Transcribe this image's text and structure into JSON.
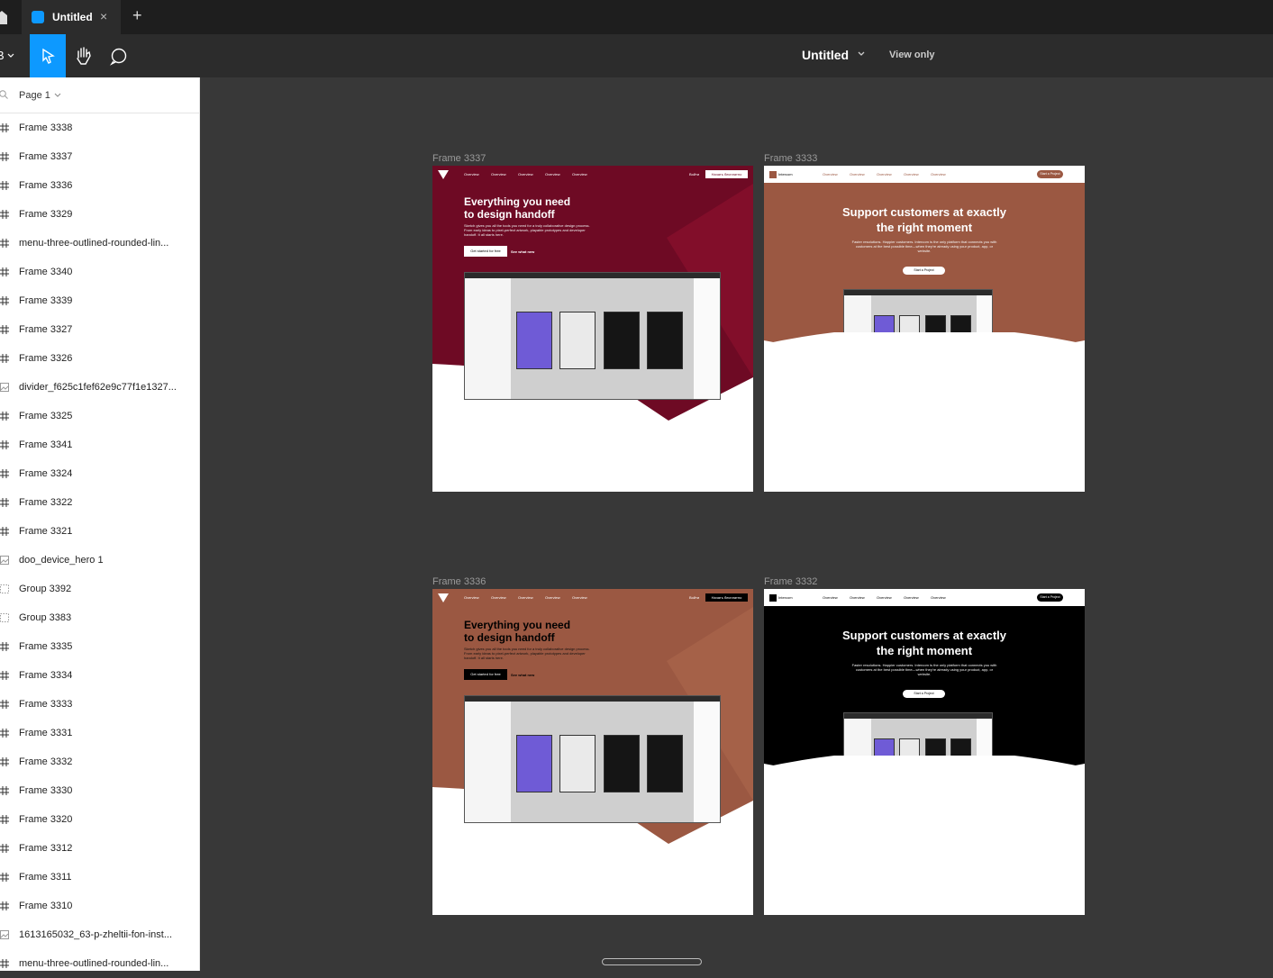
{
  "tab": {
    "title": "Untitled",
    "close": "×",
    "add": "+"
  },
  "toolbar": {
    "doc_title": "Untitled",
    "view_only": "View only"
  },
  "page": {
    "label": "Page 1"
  },
  "layers": [
    {
      "name": "Frame 3338",
      "type": "frame"
    },
    {
      "name": "Frame 3337",
      "type": "frame"
    },
    {
      "name": "Frame 3336",
      "type": "frame"
    },
    {
      "name": "Frame 3329",
      "type": "frame"
    },
    {
      "name": "menu-three-outlined-rounded-lin...",
      "type": "frame"
    },
    {
      "name": "Frame 3340",
      "type": "frame"
    },
    {
      "name": "Frame 3339",
      "type": "frame"
    },
    {
      "name": "Frame 3327",
      "type": "frame"
    },
    {
      "name": "Frame 3326",
      "type": "frame"
    },
    {
      "name": "divider_f625c1fef62e9c77f1e1327...",
      "type": "image"
    },
    {
      "name": "Frame 3325",
      "type": "frame"
    },
    {
      "name": "Frame 3341",
      "type": "frame"
    },
    {
      "name": "Frame 3324",
      "type": "frame"
    },
    {
      "name": "Frame 3322",
      "type": "frame"
    },
    {
      "name": "Frame 3321",
      "type": "frame"
    },
    {
      "name": "doo_device_hero 1",
      "type": "image"
    },
    {
      "name": "Group 3392",
      "type": "group"
    },
    {
      "name": "Group 3383",
      "type": "group"
    },
    {
      "name": "Frame 3335",
      "type": "frame"
    },
    {
      "name": "Frame 3334",
      "type": "frame"
    },
    {
      "name": "Frame 3333",
      "type": "frame"
    },
    {
      "name": "Frame 3331",
      "type": "frame"
    },
    {
      "name": "Frame 3332",
      "type": "frame"
    },
    {
      "name": "Frame 3330",
      "type": "frame"
    },
    {
      "name": "Frame 3320",
      "type": "frame"
    },
    {
      "name": "Frame 3312",
      "type": "frame"
    },
    {
      "name": "Frame 3311",
      "type": "frame"
    },
    {
      "name": "Frame 3310",
      "type": "frame"
    },
    {
      "name": "1613165032_63-p-zheltii-fon-inst...",
      "type": "image"
    },
    {
      "name": "menu-three-outlined-rounded-lin...",
      "type": "frame"
    }
  ],
  "frames": {
    "f3337": {
      "label": "Frame 3337",
      "bg": "#6e0a24",
      "accent": "#8a0f2e",
      "headline1": "Everything you need",
      "headline2": "to design handoff",
      "body": "Sketch gives you all the tools you need for a truly collaborative design process. From early ideas to pixel-perfect artwork, playable prototypes and developer handoff. It all starts here.",
      "cta": "Get started for free",
      "link": "See what new",
      "nav_right": "Войти",
      "nav_button": "Начать бесплатно",
      "nav": [
        "Overview",
        "Overview",
        "Overview",
        "Overview",
        "Overview"
      ]
    },
    "f3333": {
      "label": "Frame 3333",
      "bg": "#9b5842",
      "headline1": "Support customers at exactly",
      "headline2": "the right moment",
      "body": "Faster resolutions. Happier customers. Intercom is the only platform that connects you with customers at the best possible time—when they're already using your product, app, or website.",
      "cta": "Start a Project",
      "brand": "Intercom",
      "nav_button": "Start a Project",
      "nav": [
        "Overview",
        "Overview",
        "Overview",
        "Overview",
        "Overview"
      ]
    },
    "f3336": {
      "label": "Frame 3336",
      "bg": "#9b5842",
      "accent": "#a9654c",
      "headline1": "Everything you need",
      "headline2": "to design handoff",
      "body": "Sketch gives you all the tools you need for a truly collaborative design process. From early ideas to pixel-perfect artwork, playable prototypes and developer handoff. It all starts here.",
      "cta": "Get started for free",
      "link": "See what new",
      "nav_right": "Войти",
      "nav_button": "Начать бесплатно",
      "nav": [
        "Overview",
        "Overview",
        "Overview",
        "Overview",
        "Overview"
      ]
    },
    "f3332": {
      "label": "Frame 3332",
      "bg": "#000000",
      "headline1": "Support customers at exactly",
      "headline2": "the right moment",
      "body": "Faster resolutions. Happier customers. Intercom is the only platform that connects you with customers at the best possible time—when they're already using your product, app, or website.",
      "cta": "Start a Project",
      "brand": "Intercom",
      "nav_button": "Start a Project",
      "nav": [
        "Overview",
        "Overview",
        "Overview",
        "Overview",
        "Overview"
      ]
    }
  }
}
